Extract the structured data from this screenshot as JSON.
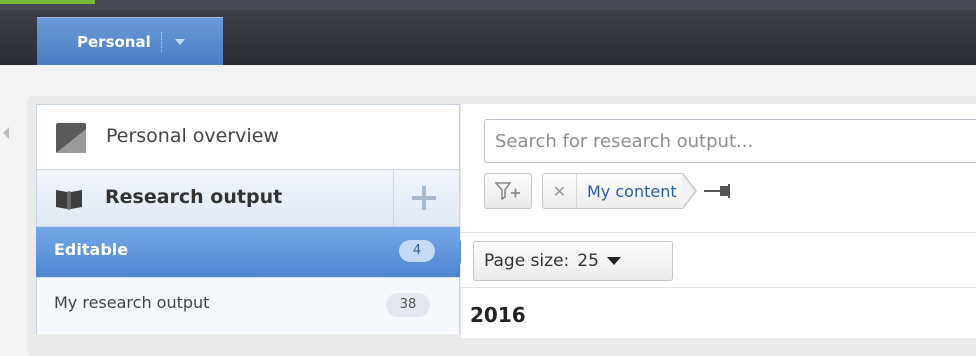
{
  "topbar": {
    "tab_label": "Personal"
  },
  "sidebar": {
    "overview_label": "Personal overview",
    "research_label": "Research output",
    "editable": {
      "label": "Editable",
      "count": "4"
    },
    "my_research": {
      "label": "My research output",
      "count": "38"
    }
  },
  "main": {
    "search_placeholder": "Search for research output...",
    "filter_chip_label": "My content",
    "page_size": {
      "label": "Page size:",
      "value": "25"
    },
    "year_heading": "2016"
  },
  "colors": {
    "accent_blue": "#4f86d2",
    "topbar": "#2a2d33",
    "tab_active": "#5a8ad0"
  }
}
